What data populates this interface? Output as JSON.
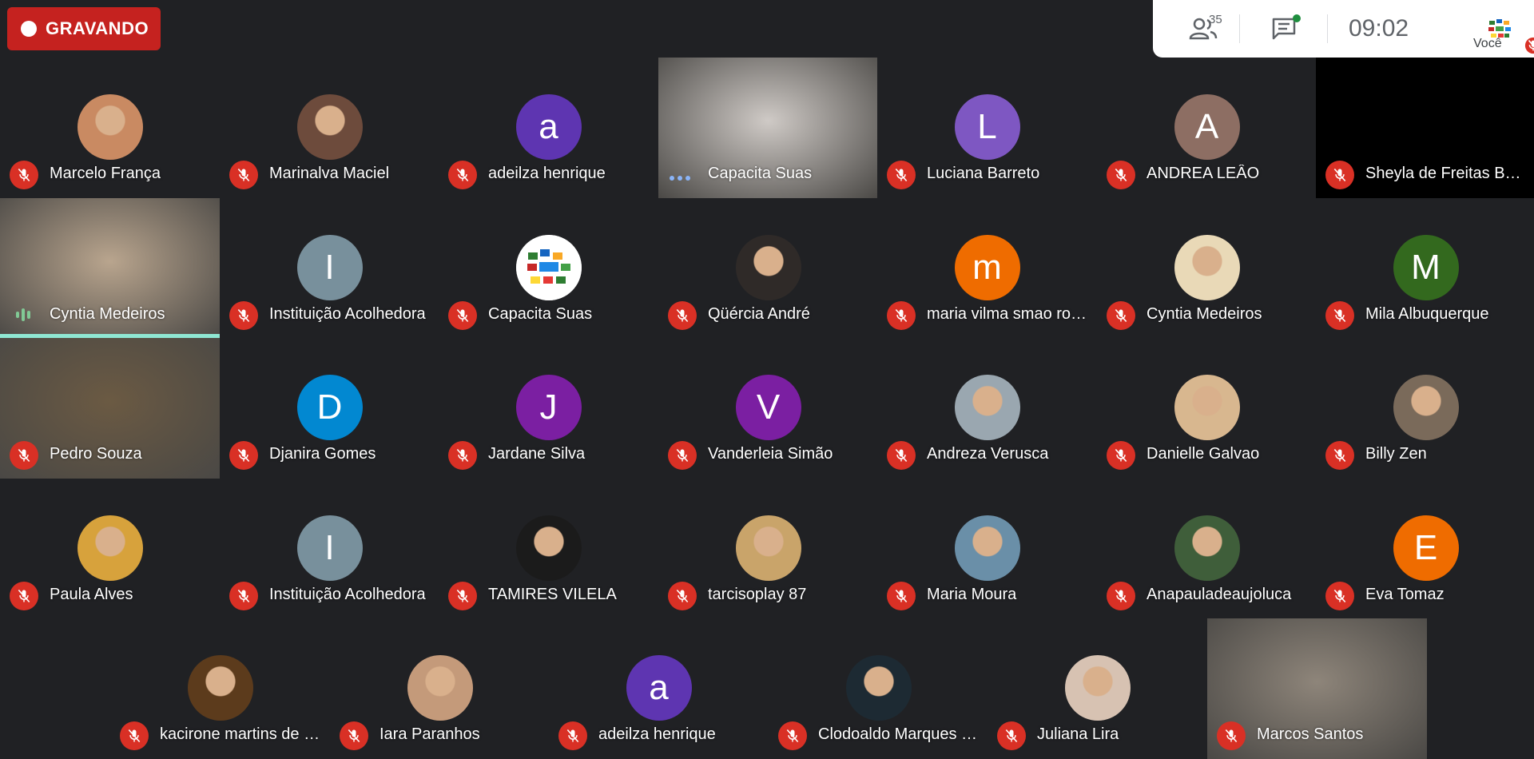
{
  "recording": {
    "label": "GRAVANDO",
    "color": "#c5221f"
  },
  "header": {
    "people_count": "35",
    "time": "09:02",
    "self_label": "Você"
  },
  "tiles": [
    {
      "name": "Marcelo França",
      "type": "photo",
      "bg": "#c98a62",
      "muted": true
    },
    {
      "name": "Marinalva Maciel",
      "type": "photo",
      "bg": "#6d4b3c",
      "muted": true
    },
    {
      "name": "adeilza henrique",
      "type": "letter",
      "letter": "a",
      "bg": "#5e35b1",
      "muted": true
    },
    {
      "name": "Capacita Suas",
      "type": "video",
      "bg": "#cfcac6",
      "muted": false,
      "indicator": "dots"
    },
    {
      "name": "Luciana Barreto",
      "type": "letter",
      "letter": "L",
      "bg": "#7e57c2",
      "muted": true
    },
    {
      "name": "ANDREA LEÂO",
      "type": "letter",
      "letter": "A",
      "bg": "#8d6e63",
      "muted": true
    },
    {
      "name": "Sheyla de Freitas Barbosa",
      "type": "video",
      "bg": "#000000",
      "muted": true
    },
    {
      "name": "Cyntia Medeiros",
      "type": "video",
      "bg": "#b9a58e",
      "muted": false,
      "indicator": "wave",
      "speaking": true
    },
    {
      "name": "Instituição Acolhedora",
      "type": "letter",
      "letter": "I",
      "bg": "#78909c",
      "muted": true
    },
    {
      "name": "Capacita Suas",
      "type": "logo",
      "bg": "#ffffff",
      "muted": true
    },
    {
      "name": "Qüércia André",
      "type": "photo",
      "bg": "#2f2a28",
      "muted": true
    },
    {
      "name": "maria vilma smao rodrigues",
      "type": "letter",
      "letter": "m",
      "bg": "#ef6c00",
      "muted": true
    },
    {
      "name": "Cyntia Medeiros",
      "type": "photo",
      "bg": "#e9d9b7",
      "muted": true
    },
    {
      "name": "Mila Albuquerque",
      "type": "letter",
      "letter": "M",
      "bg": "#33691e",
      "muted": true
    },
    {
      "name": "Pedro Souza",
      "type": "video",
      "bg": "#6b5a43",
      "muted": true
    },
    {
      "name": "Djanira Gomes",
      "type": "letter",
      "letter": "D",
      "bg": "#0288d1",
      "muted": true
    },
    {
      "name": "Jardane Silva",
      "type": "letter",
      "letter": "J",
      "bg": "#7b1fa2",
      "muted": true
    },
    {
      "name": "Vanderleia Simão",
      "type": "letter",
      "letter": "V",
      "bg": "#7b1fa2",
      "muted": true
    },
    {
      "name": "Andreza Verusca",
      "type": "photo",
      "bg": "#9aa7b0",
      "muted": true
    },
    {
      "name": "Danielle Galvao",
      "type": "photo",
      "bg": "#d8b78f",
      "muted": true
    },
    {
      "name": "Billy Zen",
      "type": "photo",
      "bg": "#7a6a5a",
      "muted": true
    },
    {
      "name": "Paula Alves",
      "type": "photo",
      "bg": "#d7a23c",
      "muted": true
    },
    {
      "name": "Instituição Acolhedora",
      "type": "letter",
      "letter": "I",
      "bg": "#78909c",
      "muted": true
    },
    {
      "name": "TAMIRES VILELA",
      "type": "photo",
      "bg": "#1b1b1b",
      "muted": true
    },
    {
      "name": "tarcisoplay 87",
      "type": "photo",
      "bg": "#c9a46a",
      "muted": true
    },
    {
      "name": "Maria Moura",
      "type": "photo",
      "bg": "#6a8fa8",
      "muted": true
    },
    {
      "name": "Anapauladeaujoluca",
      "type": "photo",
      "bg": "#3f5e3a",
      "muted": true
    },
    {
      "name": "Eva Tomaz",
      "type": "letter",
      "letter": "E",
      "bg": "#ef6c00",
      "muted": true
    },
    {
      "name": "kacirone martins de sousa",
      "type": "photo",
      "bg": "#5c3b1c",
      "muted": true
    },
    {
      "name": "Iara Paranhos",
      "type": "photo",
      "bg": "#c49a7a",
      "muted": true
    },
    {
      "name": "adeilza henrique",
      "type": "letter",
      "letter": "a",
      "bg": "#5e35b1",
      "muted": true
    },
    {
      "name": "Clodoaldo Marques da Silva",
      "type": "photo",
      "bg": "#1d2a33",
      "muted": true
    },
    {
      "name": "Juliana Lira",
      "type": "photo",
      "bg": "#d7c2b2",
      "muted": true
    },
    {
      "name": "Marcos Santos",
      "type": "video",
      "bg": "#8e857a",
      "muted": true
    }
  ]
}
